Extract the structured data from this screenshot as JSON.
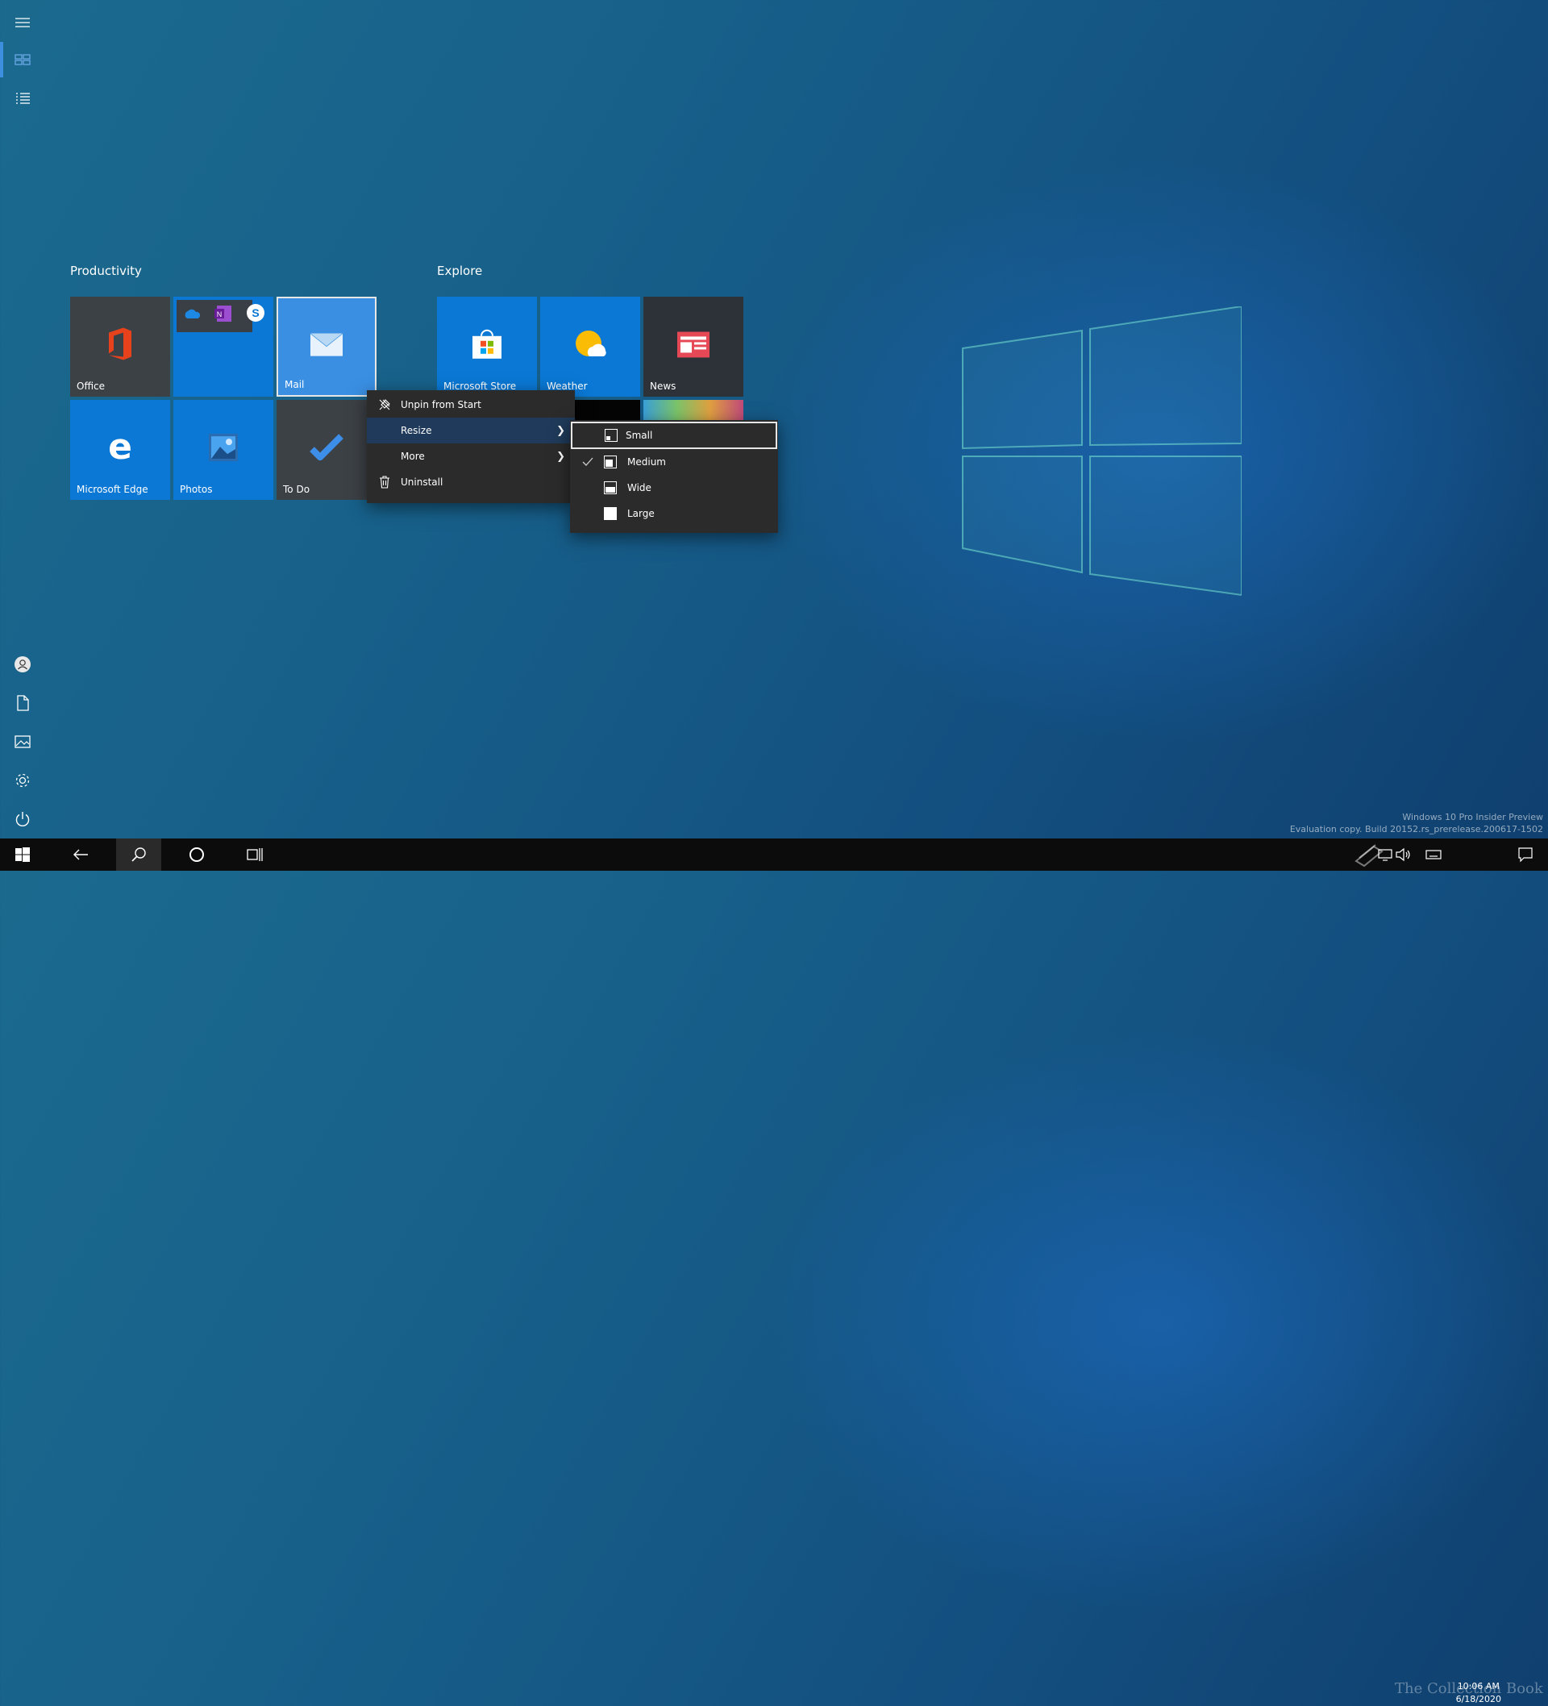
{
  "groups": [
    {
      "title": "Productivity"
    },
    {
      "title": "Explore"
    }
  ],
  "tiles": {
    "office": {
      "label": "Office"
    },
    "mail": {
      "label": "Mail"
    },
    "edge": {
      "label": "Microsoft Edge"
    },
    "photos": {
      "label": "Photos"
    },
    "todo": {
      "label": "To Do"
    },
    "store": {
      "label": "Microsoft Store"
    },
    "weather": {
      "label": "Weather"
    },
    "news": {
      "label": "News"
    }
  },
  "context_menu": {
    "items": [
      {
        "label": "Unpin from Start",
        "icon": "unpin-icon"
      },
      {
        "label": "Resize",
        "icon": "",
        "submenu": true
      },
      {
        "label": "More",
        "icon": "",
        "submenu": true
      },
      {
        "label": "Uninstall",
        "icon": "trash-icon"
      }
    ]
  },
  "resize_menu": {
    "items": [
      {
        "label": "Small",
        "checked": false,
        "focused": true
      },
      {
        "label": "Medium",
        "checked": true
      },
      {
        "label": "Wide",
        "checked": false
      },
      {
        "label": "Large",
        "checked": false
      }
    ]
  },
  "system": {
    "watermark_line1": "Windows 10 Pro Insider Preview",
    "watermark_line2": "Evaluation copy. Build 20152.rs_prerelease.200617-1502",
    "time": "10:06 AM",
    "date": "6/18/2020",
    "brand": "The Collection Book"
  },
  "colors": {
    "tile_blue": "#0a78d4",
    "tile_dark": "#3c4146",
    "menu_bg": "#2b2b2b",
    "menu_hover": "#1f3a5a",
    "taskbar": "#0c0c0c"
  }
}
